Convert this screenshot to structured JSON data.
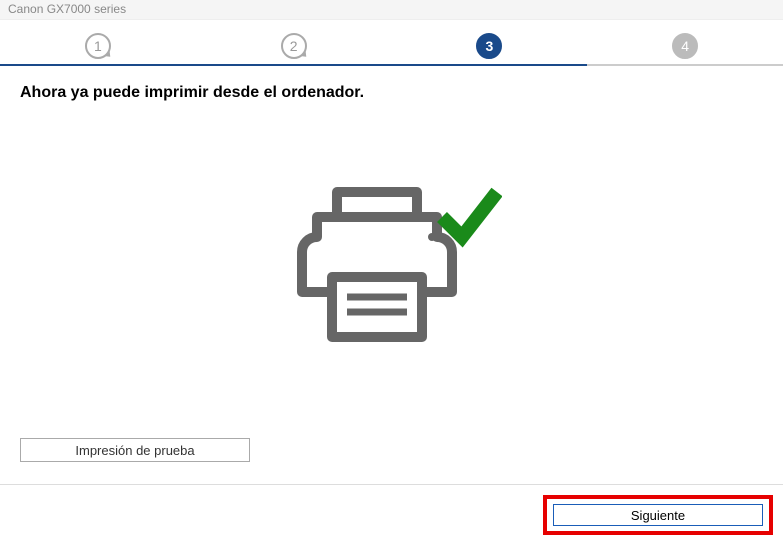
{
  "window": {
    "title": "Canon GX7000 series"
  },
  "stepper": {
    "steps": [
      "1",
      "2",
      "3",
      "4"
    ],
    "active_index": 2
  },
  "content": {
    "message": "Ahora ya puede imprimir desde el ordenador."
  },
  "buttons": {
    "test_print": "Impresión de prueba",
    "next": "Siguiente"
  },
  "icons": {
    "printer": "printer-icon",
    "checkmark": "checkmark-icon"
  },
  "colors": {
    "accent": "#1a4a8a",
    "success": "#1a8a1a",
    "highlight": "#e60000"
  }
}
